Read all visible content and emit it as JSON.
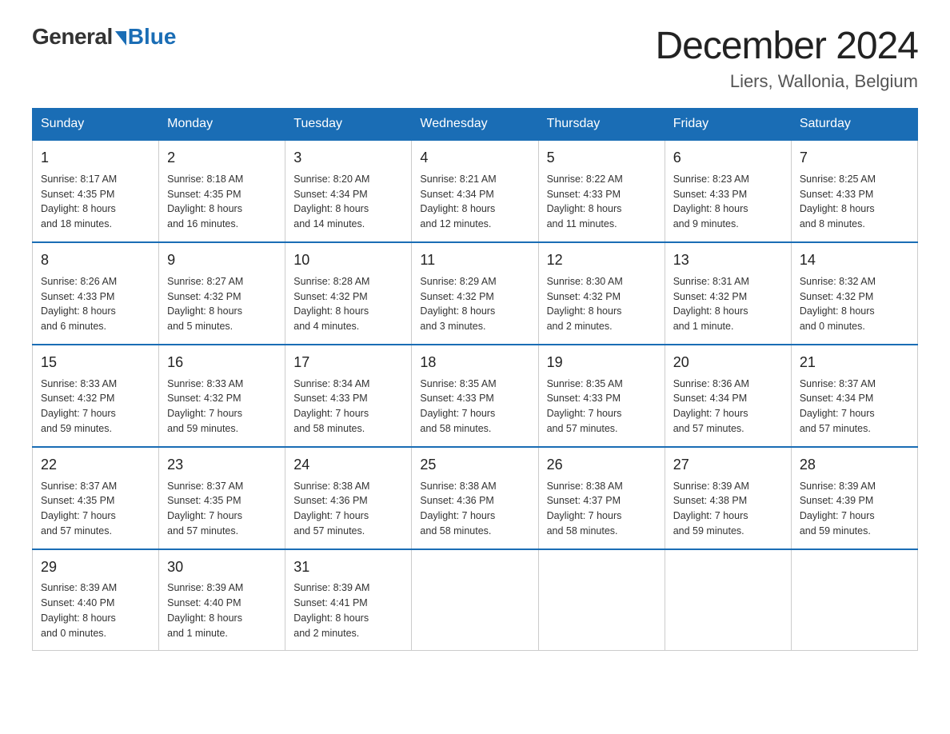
{
  "logo": {
    "general": "General",
    "blue": "Blue"
  },
  "title": "December 2024",
  "location": "Liers, Wallonia, Belgium",
  "days_of_week": [
    "Sunday",
    "Monday",
    "Tuesday",
    "Wednesday",
    "Thursday",
    "Friday",
    "Saturday"
  ],
  "weeks": [
    [
      {
        "day": "1",
        "info": "Sunrise: 8:17 AM\nSunset: 4:35 PM\nDaylight: 8 hours\nand 18 minutes."
      },
      {
        "day": "2",
        "info": "Sunrise: 8:18 AM\nSunset: 4:35 PM\nDaylight: 8 hours\nand 16 minutes."
      },
      {
        "day": "3",
        "info": "Sunrise: 8:20 AM\nSunset: 4:34 PM\nDaylight: 8 hours\nand 14 minutes."
      },
      {
        "day": "4",
        "info": "Sunrise: 8:21 AM\nSunset: 4:34 PM\nDaylight: 8 hours\nand 12 minutes."
      },
      {
        "day": "5",
        "info": "Sunrise: 8:22 AM\nSunset: 4:33 PM\nDaylight: 8 hours\nand 11 minutes."
      },
      {
        "day": "6",
        "info": "Sunrise: 8:23 AM\nSunset: 4:33 PM\nDaylight: 8 hours\nand 9 minutes."
      },
      {
        "day": "7",
        "info": "Sunrise: 8:25 AM\nSunset: 4:33 PM\nDaylight: 8 hours\nand 8 minutes."
      }
    ],
    [
      {
        "day": "8",
        "info": "Sunrise: 8:26 AM\nSunset: 4:33 PM\nDaylight: 8 hours\nand 6 minutes."
      },
      {
        "day": "9",
        "info": "Sunrise: 8:27 AM\nSunset: 4:32 PM\nDaylight: 8 hours\nand 5 minutes."
      },
      {
        "day": "10",
        "info": "Sunrise: 8:28 AM\nSunset: 4:32 PM\nDaylight: 8 hours\nand 4 minutes."
      },
      {
        "day": "11",
        "info": "Sunrise: 8:29 AM\nSunset: 4:32 PM\nDaylight: 8 hours\nand 3 minutes."
      },
      {
        "day": "12",
        "info": "Sunrise: 8:30 AM\nSunset: 4:32 PM\nDaylight: 8 hours\nand 2 minutes."
      },
      {
        "day": "13",
        "info": "Sunrise: 8:31 AM\nSunset: 4:32 PM\nDaylight: 8 hours\nand 1 minute."
      },
      {
        "day": "14",
        "info": "Sunrise: 8:32 AM\nSunset: 4:32 PM\nDaylight: 8 hours\nand 0 minutes."
      }
    ],
    [
      {
        "day": "15",
        "info": "Sunrise: 8:33 AM\nSunset: 4:32 PM\nDaylight: 7 hours\nand 59 minutes."
      },
      {
        "day": "16",
        "info": "Sunrise: 8:33 AM\nSunset: 4:32 PM\nDaylight: 7 hours\nand 59 minutes."
      },
      {
        "day": "17",
        "info": "Sunrise: 8:34 AM\nSunset: 4:33 PM\nDaylight: 7 hours\nand 58 minutes."
      },
      {
        "day": "18",
        "info": "Sunrise: 8:35 AM\nSunset: 4:33 PM\nDaylight: 7 hours\nand 58 minutes."
      },
      {
        "day": "19",
        "info": "Sunrise: 8:35 AM\nSunset: 4:33 PM\nDaylight: 7 hours\nand 57 minutes."
      },
      {
        "day": "20",
        "info": "Sunrise: 8:36 AM\nSunset: 4:34 PM\nDaylight: 7 hours\nand 57 minutes."
      },
      {
        "day": "21",
        "info": "Sunrise: 8:37 AM\nSunset: 4:34 PM\nDaylight: 7 hours\nand 57 minutes."
      }
    ],
    [
      {
        "day": "22",
        "info": "Sunrise: 8:37 AM\nSunset: 4:35 PM\nDaylight: 7 hours\nand 57 minutes."
      },
      {
        "day": "23",
        "info": "Sunrise: 8:37 AM\nSunset: 4:35 PM\nDaylight: 7 hours\nand 57 minutes."
      },
      {
        "day": "24",
        "info": "Sunrise: 8:38 AM\nSunset: 4:36 PM\nDaylight: 7 hours\nand 57 minutes."
      },
      {
        "day": "25",
        "info": "Sunrise: 8:38 AM\nSunset: 4:36 PM\nDaylight: 7 hours\nand 58 minutes."
      },
      {
        "day": "26",
        "info": "Sunrise: 8:38 AM\nSunset: 4:37 PM\nDaylight: 7 hours\nand 58 minutes."
      },
      {
        "day": "27",
        "info": "Sunrise: 8:39 AM\nSunset: 4:38 PM\nDaylight: 7 hours\nand 59 minutes."
      },
      {
        "day": "28",
        "info": "Sunrise: 8:39 AM\nSunset: 4:39 PM\nDaylight: 7 hours\nand 59 minutes."
      }
    ],
    [
      {
        "day": "29",
        "info": "Sunrise: 8:39 AM\nSunset: 4:40 PM\nDaylight: 8 hours\nand 0 minutes."
      },
      {
        "day": "30",
        "info": "Sunrise: 8:39 AM\nSunset: 4:40 PM\nDaylight: 8 hours\nand 1 minute."
      },
      {
        "day": "31",
        "info": "Sunrise: 8:39 AM\nSunset: 4:41 PM\nDaylight: 8 hours\nand 2 minutes."
      },
      {
        "day": "",
        "info": ""
      },
      {
        "day": "",
        "info": ""
      },
      {
        "day": "",
        "info": ""
      },
      {
        "day": "",
        "info": ""
      }
    ]
  ]
}
